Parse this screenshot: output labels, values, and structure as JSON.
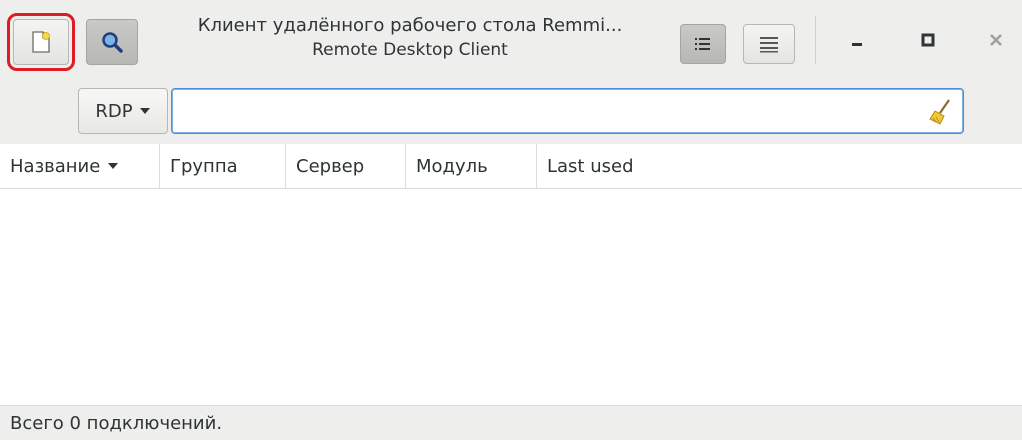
{
  "window": {
    "title": "Клиент удалённого рабочего стола Remmi...",
    "subtitle": "Remote Desktop Client"
  },
  "header": {
    "new_connection_icon": "new-document-icon",
    "search_toggle_icon": "search-icon",
    "view_list_icon": "list-view-icon",
    "view_tree_icon": "tree-view-icon",
    "minimize_icon": "minimize-icon",
    "maximize_icon": "maximize-icon",
    "close_icon": "close-icon"
  },
  "search": {
    "protocol_selected": "RDP",
    "value": "",
    "placeholder": "",
    "clear_icon": "broom-clear-icon"
  },
  "columns": [
    {
      "label": "Название"
    },
    {
      "label": "Группа"
    },
    {
      "label": "Сервер"
    },
    {
      "label": "Модуль"
    },
    {
      "label": "Last used"
    }
  ],
  "rows": [],
  "status": {
    "text": "Всего 0 подключений."
  },
  "colors": {
    "highlight": "#e01b24",
    "focus": "#4a90d9",
    "chrome": "#eeeeec"
  }
}
